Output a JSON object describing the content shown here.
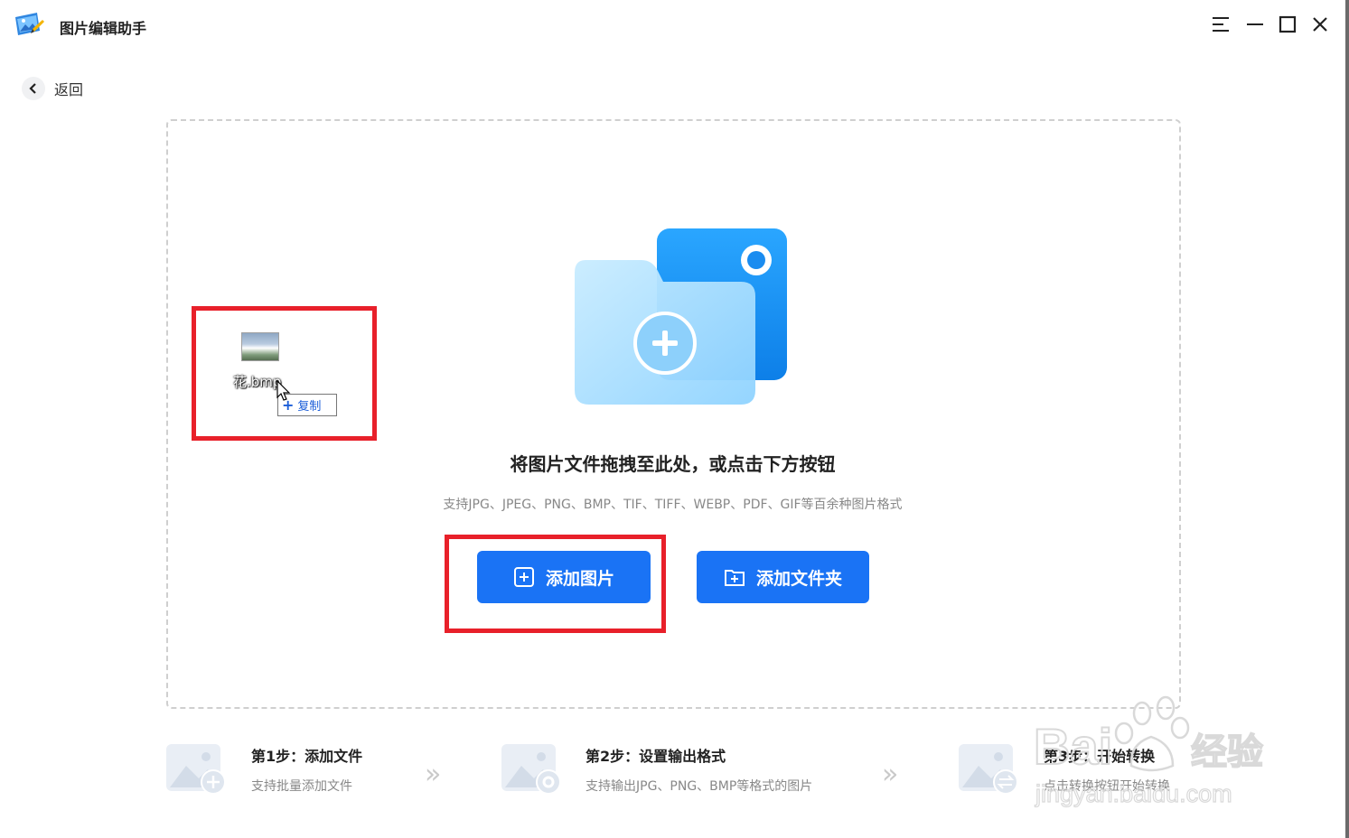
{
  "app": {
    "title": "图片编辑助手"
  },
  "window_controls": {
    "menu_icon": "menu-icon",
    "minimize_icon": "minimize-icon",
    "maximize_icon": "maximize-icon",
    "close_icon": "close-icon"
  },
  "nav": {
    "back_label": "返回"
  },
  "dropzone": {
    "title": "将图片文件拖拽至此处，或点击下方按钮",
    "subtitle": "支持JPG、JPEG、PNG、BMP、TIF、TIFF、WEBP、PDF、GIF等百余种图片格式",
    "add_image_label": "添加图片",
    "add_folder_label": "添加文件夹"
  },
  "drag_ghost": {
    "file_name": "花.bmp",
    "tooltip": "复制"
  },
  "steps": [
    {
      "title": "第1步：添加文件",
      "desc": "支持批量添加文件"
    },
    {
      "title": "第2步：设置输出格式",
      "desc": "支持输出JPG、PNG、BMP等格式的图片"
    },
    {
      "title": "第3步：开始转换",
      "desc": "点击转换按钮开始转换"
    }
  ],
  "watermark": {
    "line1": "Bai",
    "line2": "经验",
    "line3": "jingyan.baidu.com"
  },
  "colors": {
    "accent": "#1a73f5",
    "highlight": "#e8202a"
  }
}
